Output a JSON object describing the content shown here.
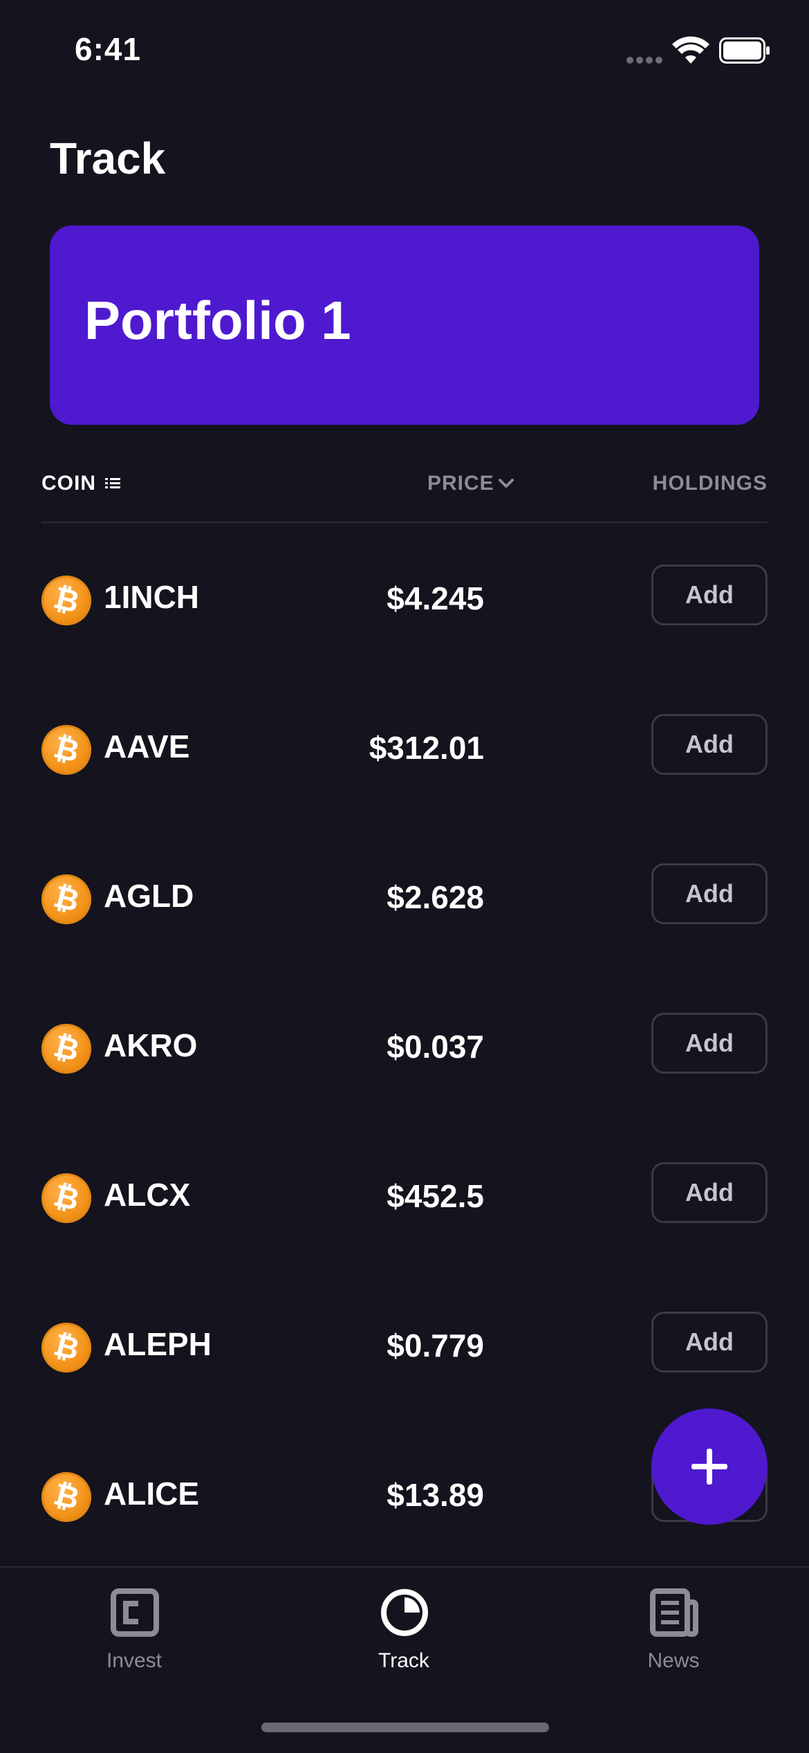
{
  "status_bar": {
    "time": "6:41"
  },
  "header": {
    "title": "Track"
  },
  "portfolio": {
    "name": "Portfolio 1",
    "color": "#4f19d0"
  },
  "table": {
    "columns": {
      "coin": "COIN",
      "price": "PRICE",
      "holdings": "HOLDINGS"
    },
    "add_label": "Add",
    "rows": [
      {
        "symbol": "1INCH",
        "price": "$4.245",
        "action": "Add"
      },
      {
        "symbol": "AAVE",
        "price": "$312.01",
        "action": "Add"
      },
      {
        "symbol": "AGLD",
        "price": "$2.628",
        "action": "Add"
      },
      {
        "symbol": "AKRO",
        "price": "$0.037",
        "action": "Add"
      },
      {
        "symbol": "ALCX",
        "price": "$452.5",
        "action": "Add"
      },
      {
        "symbol": "ALEPH",
        "price": "$0.779",
        "action": "Add"
      },
      {
        "symbol": "ALICE",
        "price": "$13.89",
        "action": "Add"
      }
    ],
    "coin_icon": "bitcoin-icon"
  },
  "fab": {
    "icon": "plus-icon"
  },
  "tab_bar": {
    "tabs": [
      {
        "label": "Invest",
        "icon": "wallet-icon",
        "active": false
      },
      {
        "label": "Track",
        "icon": "pie-chart-icon",
        "active": true
      },
      {
        "label": "News",
        "icon": "newspaper-icon",
        "active": false
      }
    ]
  },
  "colors": {
    "background": "#14131e",
    "accent": "#4f19d0",
    "coin": "#f29118"
  }
}
